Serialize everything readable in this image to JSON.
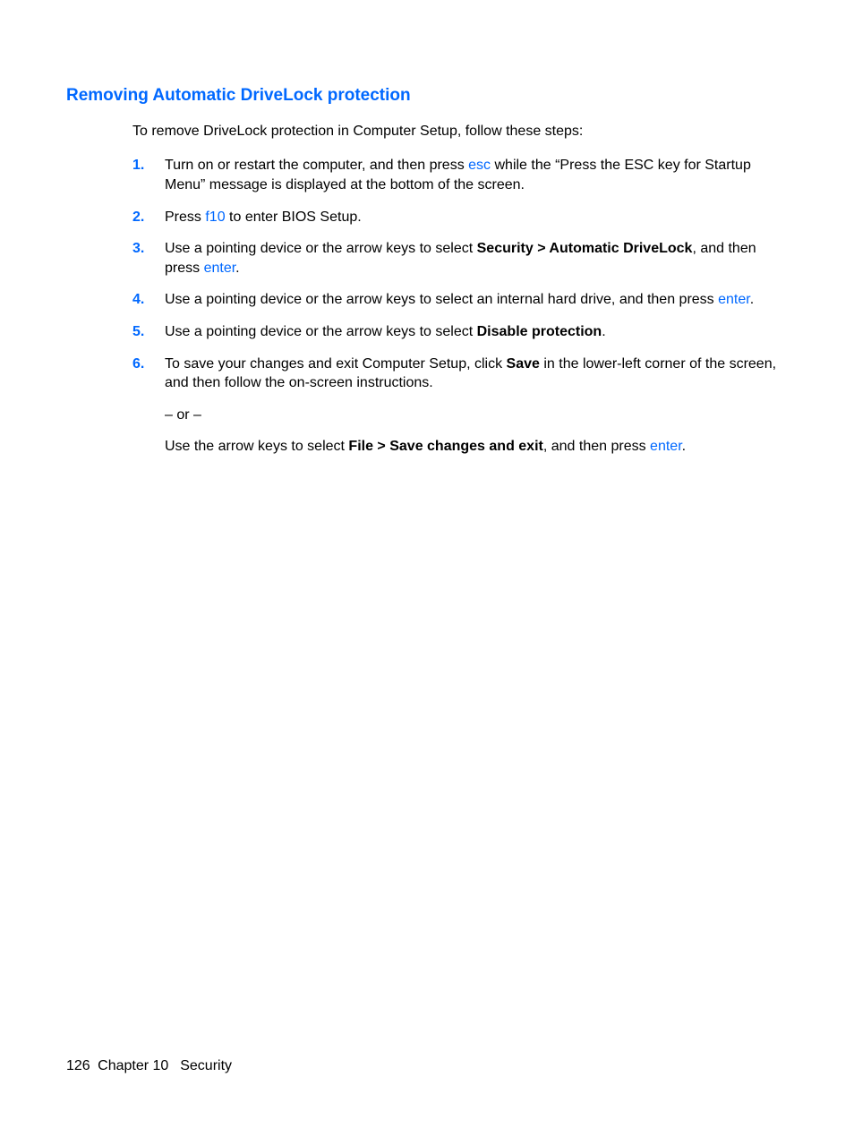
{
  "heading": "Removing Automatic DriveLock protection",
  "intro": "To remove DriveLock protection in Computer Setup, follow these steps:",
  "steps": {
    "s1": {
      "num": "1.",
      "t1": "Turn on or restart the computer, and then press ",
      "k1": "esc",
      "t2": " while the “Press the ESC key for Startup Menu” message is displayed at the bottom of the screen."
    },
    "s2": {
      "num": "2.",
      "t1": "Press ",
      "k1": "f10",
      "t2": " to enter BIOS Setup."
    },
    "s3": {
      "num": "3.",
      "t1": "Use a pointing device or the arrow keys to select ",
      "b1": "Security > Automatic DriveLock",
      "t2": ", and then press ",
      "k1": "enter",
      "t3": "."
    },
    "s4": {
      "num": "4.",
      "t1": "Use a pointing device or the arrow keys to select an internal hard drive, and then press ",
      "k1": "enter",
      "t2": "."
    },
    "s5": {
      "num": "5.",
      "t1": "Use a pointing device or the arrow keys to select ",
      "b1": "Disable protection",
      "t2": "."
    },
    "s6": {
      "num": "6.",
      "p1_t1": "To save your changes and exit Computer Setup, click ",
      "p1_b1": "Save",
      "p1_t2": " in the lower-left corner of the screen, and then follow the on-screen instructions.",
      "p2": "– or –",
      "p3_t1": "Use the arrow keys to select ",
      "p3_b1": "File > Save changes and exit",
      "p3_t2": ", and then press ",
      "p3_k1": "enter",
      "p3_t3": "."
    }
  },
  "footer": {
    "page": "126",
    "chapter": "Chapter 10",
    "title": "Security"
  }
}
